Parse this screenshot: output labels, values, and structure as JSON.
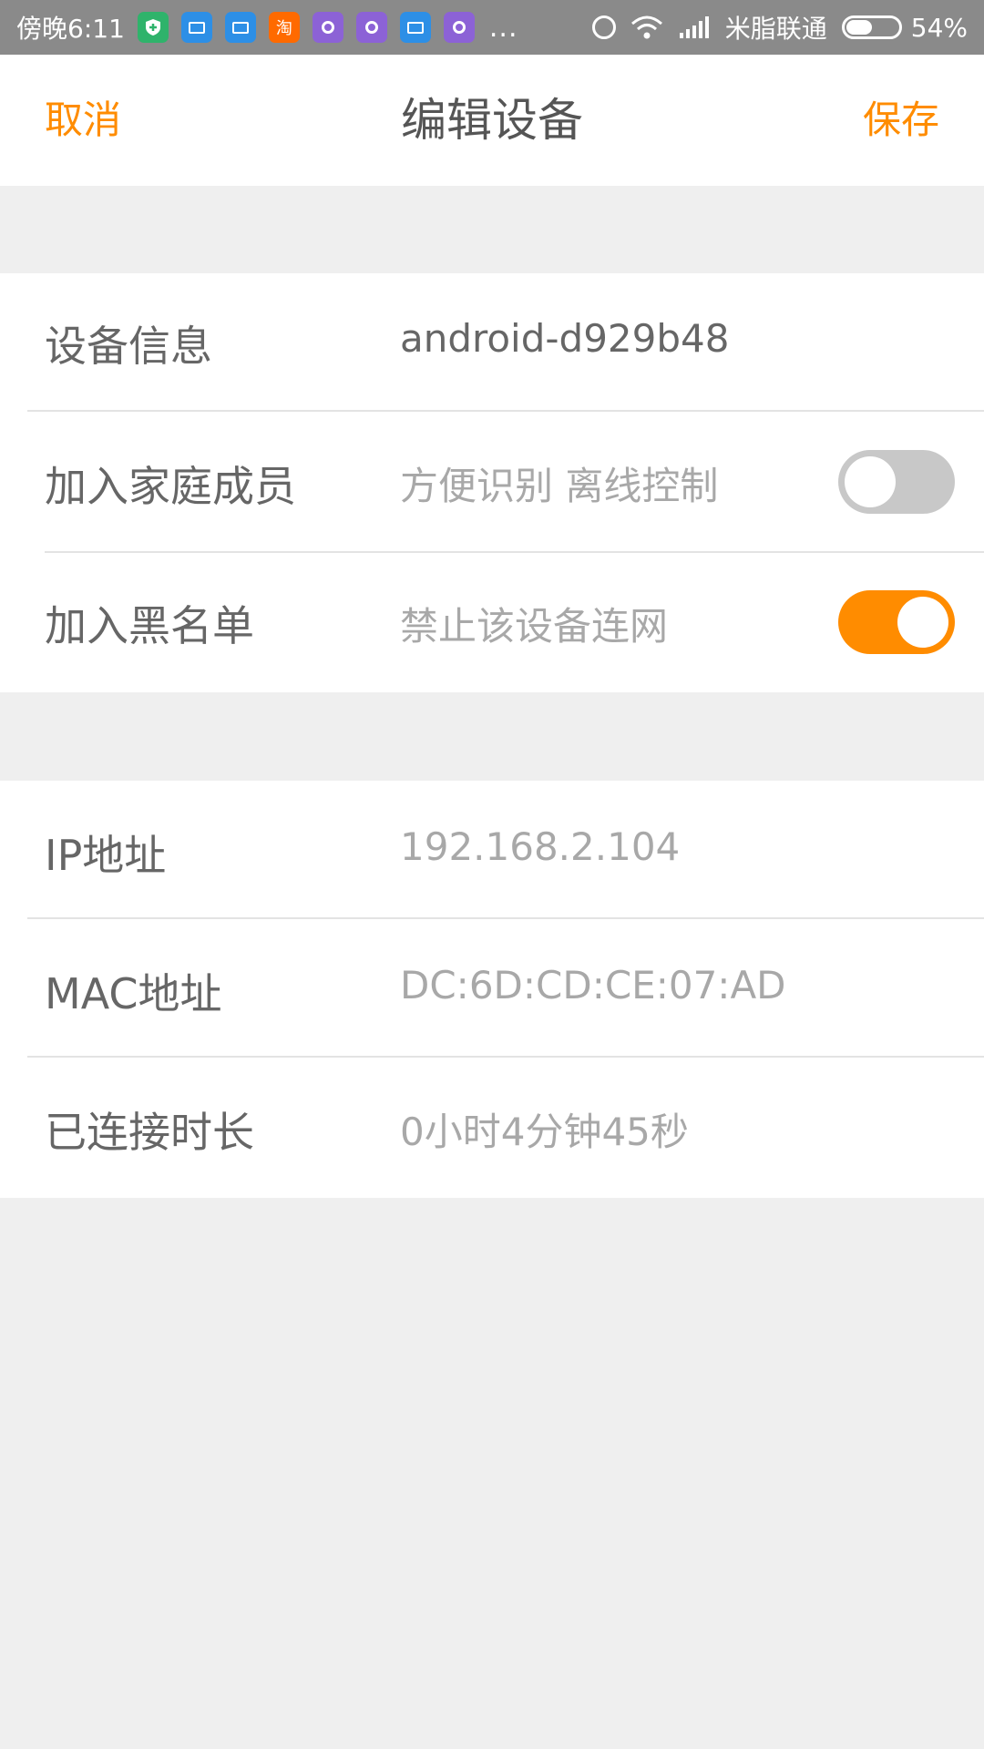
{
  "status_bar": {
    "time": "傍晚6:11",
    "app_icons": [
      {
        "name": "shield-app-icon",
        "color": "#2fb36b",
        "glyph": "shield"
      },
      {
        "name": "news-app-icon",
        "color": "#2d8fe6",
        "glyph": "card"
      },
      {
        "name": "news-app-icon-2",
        "color": "#2d8fe6",
        "glyph": "card"
      },
      {
        "name": "taobao-app-icon",
        "color": "#ff6a00",
        "glyph": "淘"
      },
      {
        "name": "purple-app-icon",
        "color": "#8c62d6",
        "glyph": "dot"
      },
      {
        "name": "purple-app-icon-2",
        "color": "#8c62d6",
        "glyph": "dot"
      },
      {
        "name": "news-app-icon-3",
        "color": "#2d8fe6",
        "glyph": "card"
      },
      {
        "name": "purple-app-icon-3",
        "color": "#8c62d6",
        "glyph": "dot"
      }
    ],
    "more": "...",
    "carrier": "米脂联通",
    "battery_percent_label": "54%",
    "battery_level": 0.54
  },
  "nav": {
    "cancel_label": "取消",
    "title": "编辑设备",
    "save_label": "保存",
    "accent": "#ff8c00"
  },
  "device_group": {
    "device_info": {
      "label": "设备信息",
      "value": "android-d929b48"
    },
    "family_member": {
      "label": "加入家庭成员",
      "hint": "方便识别 离线控制",
      "enabled": false
    },
    "blacklist": {
      "label": "加入黑名单",
      "hint": "禁止该设备连网",
      "enabled": true
    }
  },
  "network_group": {
    "ip": {
      "label": "IP地址",
      "value": "192.168.2.104"
    },
    "mac": {
      "label": "MAC地址",
      "value": "DC:6D:CD:CE:07:AD"
    },
    "duration": {
      "label": "已连接时长",
      "value": "0小时4分钟45秒"
    }
  }
}
